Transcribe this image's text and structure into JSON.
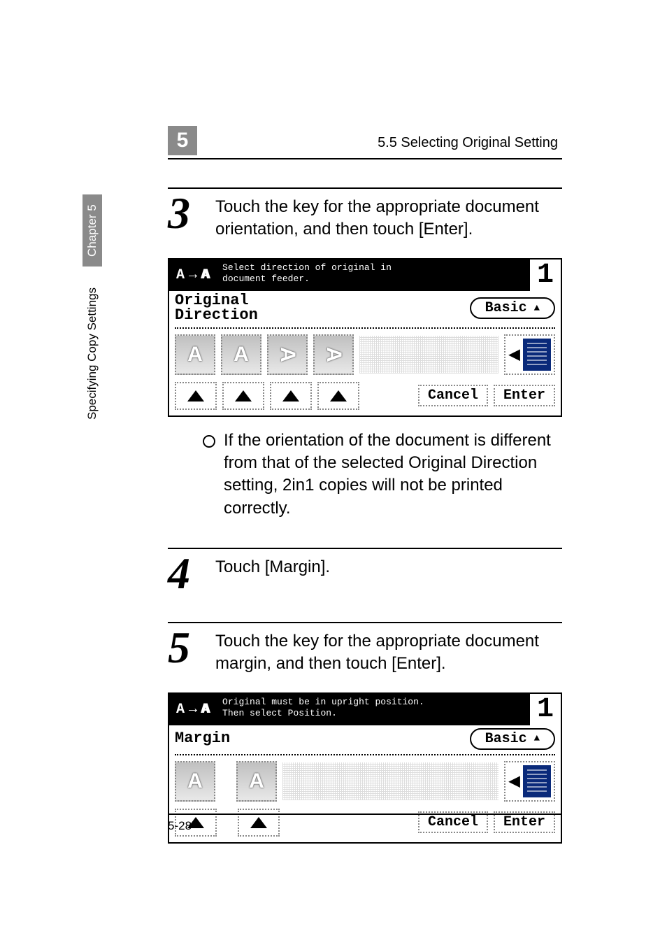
{
  "header": {
    "chapter_badge": "5",
    "title": "5.5 Selecting Original Setting"
  },
  "side": {
    "section": "Specifying Copy Settings",
    "chapter": "Chapter 5"
  },
  "steps": {
    "s3": {
      "num": "3",
      "text": "Touch the key for the appropriate document orientation, and then touch [Enter]."
    },
    "s4": {
      "num": "4",
      "text": "Touch [Margin]."
    },
    "s5": {
      "num": "5",
      "text": "Touch the key for the appropriate document margin, and then touch [Enter]."
    }
  },
  "note": "If the orientation of the document is different from that of the selected Original Direction setting, 2in1 copies will not be printed correctly.",
  "lcd1": {
    "caption": "Select direction of original in\ndocument feeder.",
    "counter": "1",
    "label_line1": "Original",
    "label_line2": "Direction",
    "basic": "Basic",
    "cancel": "Cancel",
    "enter": "Enter"
  },
  "lcd2": {
    "caption": "Original must be in upright position.\nThen select Position.",
    "counter": "1",
    "label": "Margin",
    "basic": "Basic",
    "cancel": "Cancel",
    "enter": "Enter"
  },
  "footer": {
    "page": "5-28"
  }
}
